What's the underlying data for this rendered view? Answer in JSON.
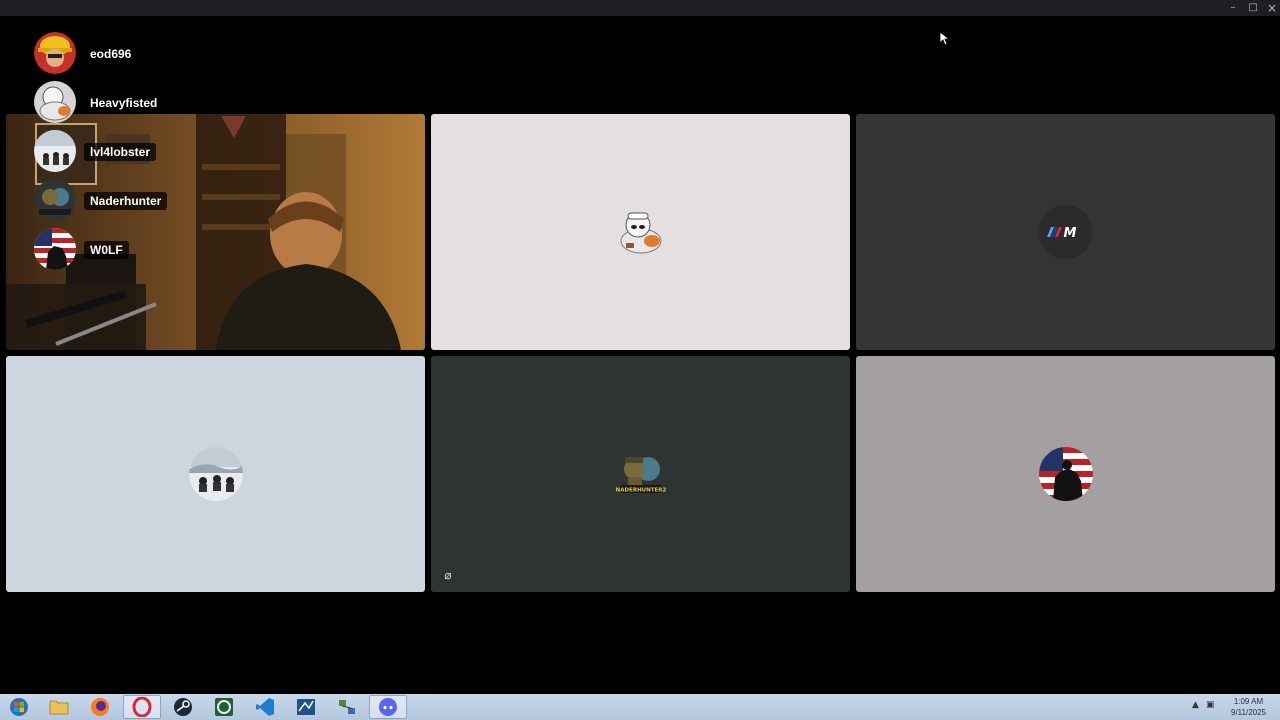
{
  "window": {
    "minimize_glyph": "–",
    "maximize_glyph": "□",
    "close_glyph": "×"
  },
  "participants": [
    {
      "name": "eod696",
      "avatar": "hard-hat-avatar-icon"
    },
    {
      "name": "Heavyfisted",
      "avatar": "cartoon-sailor-avatar-icon"
    },
    {
      "name": "lvl4lobster",
      "avatar": "soldiers-snow-avatar-icon"
    },
    {
      "name": "Naderhunter",
      "avatar": "naderhunter-logo-avatar-icon"
    },
    {
      "name": "W0LF",
      "avatar": "american-flag-soldier-avatar-icon"
    }
  ],
  "tiles": [
    {
      "type": "camera",
      "bg": "#5a3a1c"
    },
    {
      "type": "avatar",
      "bg": "#e4e0df",
      "avatar": "cartoon-sailor-avatar-icon"
    },
    {
      "type": "avatar",
      "bg": "#333436",
      "avatar": "bmw-m-logo-avatar-icon"
    },
    {
      "type": "avatar",
      "bg": "#cdd6de",
      "avatar": "soldiers-snow-avatar-icon"
    },
    {
      "type": "avatar",
      "bg": "#2e3432",
      "avatar": "naderhunter-logo-avatar-icon",
      "muted": true
    },
    {
      "type": "avatar",
      "bg": "#a39fa3",
      "avatar": "american-flag-soldier-avatar-icon"
    }
  ],
  "tile_overlay": {
    "muted_glyph": "⌀"
  },
  "avatar_text": {
    "naderhunter": "NADERHUNTER2"
  },
  "taskbar": {
    "apps": [
      {
        "name": "start-button",
        "icon": "windows-logo-icon"
      },
      {
        "name": "file-explorer",
        "icon": "folder-icon"
      },
      {
        "name": "firefox",
        "icon": "firefox-icon"
      },
      {
        "name": "opera",
        "icon": "opera-icon",
        "active": true
      },
      {
        "name": "steam",
        "icon": "steam-icon"
      },
      {
        "name": "cheat-engine",
        "icon": "cheat-engine-icon"
      },
      {
        "name": "vscode",
        "icon": "vscode-icon"
      },
      {
        "name": "blue-app",
        "icon": "mail-blue-icon"
      },
      {
        "name": "network-app",
        "icon": "network-icon"
      },
      {
        "name": "discord",
        "icon": "discord-icon",
        "active": true
      }
    ],
    "tray_glyphs": {
      "show_hidden": "▲",
      "network": "▣"
    },
    "time": "1:09 AM",
    "date": "9/11/2025"
  }
}
